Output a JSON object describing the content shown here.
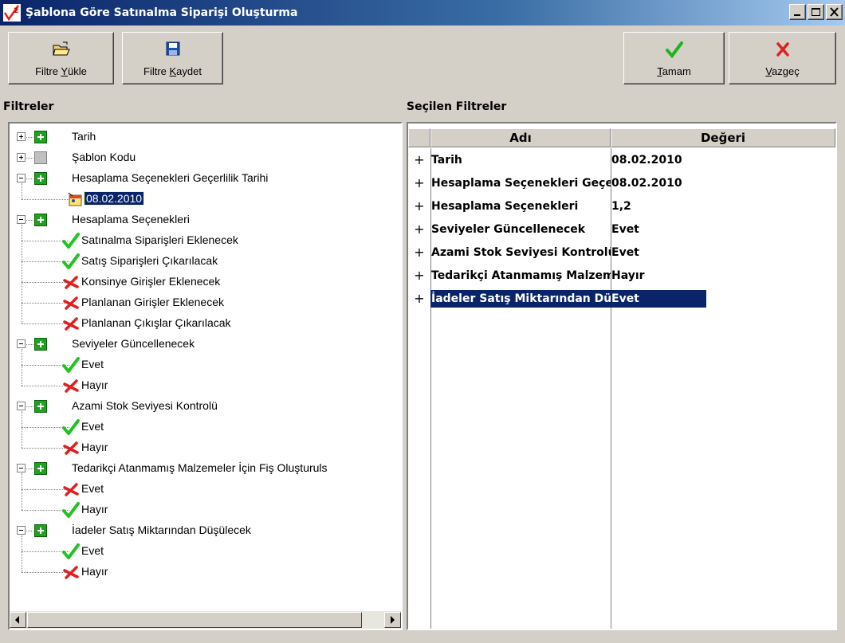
{
  "window": {
    "title": "Şablona Göre Satınalma Siparişi Oluşturma"
  },
  "toolbar": {
    "load_pre": "Filtre ",
    "load_accel": "Y",
    "load_post": "ükle",
    "save_pre": "Filtre ",
    "save_accel": "K",
    "save_post": "aydet",
    "ok_pre": "",
    "ok_accel": "T",
    "ok_post": "amam",
    "cancel_pre": "",
    "cancel_accel": "V",
    "cancel_post": "azgeç"
  },
  "filters": {
    "header": "Filtreler",
    "tree": [
      {
        "label": "Tarih"
      },
      {
        "label": "Şablon Kodu"
      },
      {
        "label": "Hesaplama Seçenekleri Geçerlilik Tarihi",
        "children": [
          {
            "label": "08.02.2010",
            "icon": "calendar-icon",
            "selected": true
          }
        ]
      },
      {
        "label": "Hesaplama Seçenekleri",
        "children": [
          {
            "label": "Satınalma Siparişleri Eklenecek",
            "icon": "check"
          },
          {
            "label": "Satış Siparişleri Çıkarılacak",
            "icon": "check"
          },
          {
            "label": "Konsinye Girişler Eklenecek",
            "icon": "cross"
          },
          {
            "label": "Planlanan Girişler Eklenecek",
            "icon": "cross"
          },
          {
            "label": "Planlanan Çıkışlar Çıkarılacak",
            "icon": "cross"
          }
        ]
      },
      {
        "label": "Seviyeler Güncellenecek",
        "children": [
          {
            "label": "Evet",
            "icon": "check"
          },
          {
            "label": "Hayır",
            "icon": "cross"
          }
        ]
      },
      {
        "label": "Azami Stok Seviyesi Kontrolü",
        "children": [
          {
            "label": "Evet",
            "icon": "check"
          },
          {
            "label": "Hayır",
            "icon": "cross"
          }
        ]
      },
      {
        "label": "Tedarikçi Atanmamış Malzemeler İçin Fiş Oluşturuls",
        "children": [
          {
            "label": "Evet",
            "icon": "cross"
          },
          {
            "label": "Hayır",
            "icon": "check"
          }
        ]
      },
      {
        "label": "İadeler Satış Miktarından Düşülecek",
        "children": [
          {
            "label": "Evet",
            "icon": "check"
          },
          {
            "label": "Hayır",
            "icon": "cross"
          }
        ]
      }
    ]
  },
  "selected": {
    "header": "Seçilen Filtreler",
    "col_name": "Adı",
    "col_value": "Değeri",
    "expander": "+",
    "rows": [
      {
        "name": "Tarih",
        "value": "08.02.2010"
      },
      {
        "name": "Hesaplama Seçenekleri Geçerlilik Tarihi",
        "value": "08.02.2010"
      },
      {
        "name": "Hesaplama Seçenekleri",
        "value": "1,2"
      },
      {
        "name": "Seviyeler Güncellenecek",
        "value": "Evet"
      },
      {
        "name": "Azami Stok Seviyesi Kontrolü",
        "value": "Evet"
      },
      {
        "name": "Tedarikçi Atanmamış Malzemeler İçin Fiş Oluşturulsun",
        "value": "Hayır"
      },
      {
        "name": "İadeler Satış Miktarından Düşülecek",
        "value": "Evet",
        "selected": true
      }
    ]
  },
  "colors": {
    "title_bar": "#0a246a",
    "selection": "#0a246a",
    "check_green": "#2ecc2e",
    "cross_red": "#e02020",
    "face": "#d4d0c8"
  }
}
